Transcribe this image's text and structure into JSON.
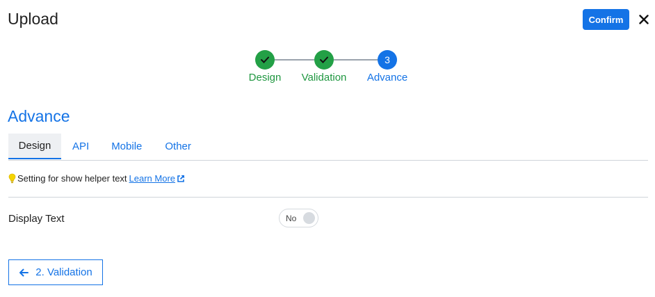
{
  "header": {
    "title": "Upload",
    "confirm_label": "Confirm",
    "close_icon": "close-icon"
  },
  "stepper": {
    "steps": [
      {
        "label": "Design",
        "state": "done",
        "marker": "✓"
      },
      {
        "label": "Validation",
        "state": "done",
        "marker": "✓"
      },
      {
        "label": "Advance",
        "state": "active",
        "marker": "3"
      }
    ]
  },
  "section": {
    "title": "Advance"
  },
  "tabs": [
    {
      "label": "Design",
      "active": true
    },
    {
      "label": "API",
      "active": false
    },
    {
      "label": "Mobile",
      "active": false
    },
    {
      "label": "Other",
      "active": false
    }
  ],
  "helper": {
    "icon": "lightbulb-icon",
    "text": "Setting for show helper text",
    "link_label": "Learn More",
    "link_icon": "external-link-icon"
  },
  "settings": {
    "display_text_label": "Display Text",
    "display_text_value": "No"
  },
  "footer": {
    "back_label": "2. Validation",
    "back_icon": "arrow-left-icon"
  },
  "colors": {
    "primary": "#1473e6",
    "success": "#23a046",
    "helper_icon": "#f5d400"
  }
}
